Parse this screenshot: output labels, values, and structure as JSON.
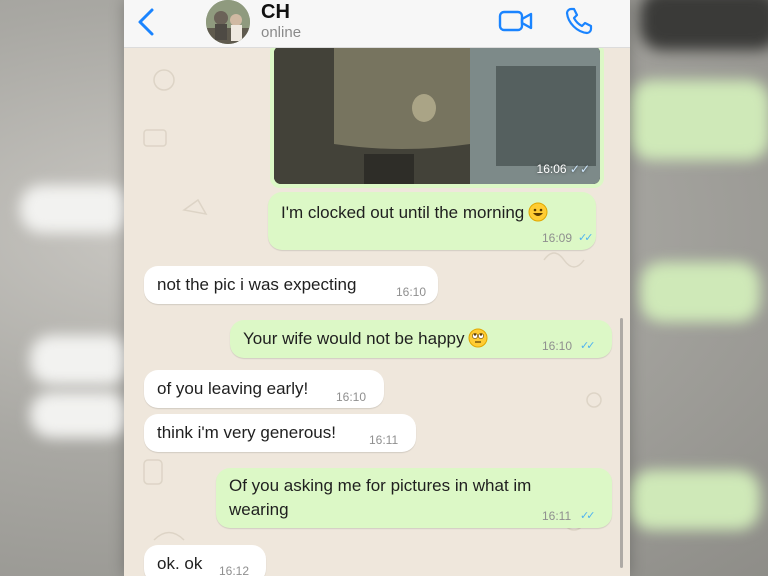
{
  "chat": {
    "contact_name": "CH",
    "status": "online"
  },
  "header_icons": {
    "back": "chevron-left-icon",
    "video": "video-camera-icon",
    "call": "phone-icon",
    "accent_color": "#1a84ff"
  },
  "photo_message": {
    "time": "16:06"
  },
  "messages": [
    {
      "direction": "outgoing",
      "text": "I'm clocked out until the morning",
      "emoji": "grinning-face-emoji",
      "time": "16:09",
      "read": true
    },
    {
      "direction": "incoming",
      "text": "not the pic i was expecting",
      "time": "16:10"
    },
    {
      "direction": "outgoing",
      "text": "Your wife would not be happy",
      "emoji": "rolling-eyes-emoji",
      "time": "16:10",
      "read": true
    },
    {
      "direction": "incoming",
      "text": "of you leaving early!",
      "time": "16:10"
    },
    {
      "direction": "incoming",
      "text": "think i'm very generous!",
      "time": "16:11"
    },
    {
      "direction": "outgoing",
      "text": "Of you asking me for pictures in what im wearing",
      "time": "16:11",
      "read": true
    },
    {
      "direction": "incoming",
      "text": "ok. ok",
      "time": "16:12"
    }
  ],
  "colors": {
    "outgoing_bubble": "#dcf8c6",
    "incoming_bubble": "#ffffff",
    "chat_background": "#efe7dc",
    "read_ticks": "#4fb3f0"
  }
}
